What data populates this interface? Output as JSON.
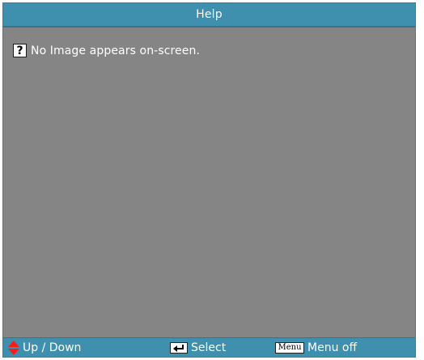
{
  "window": {
    "title": "Help"
  },
  "help": {
    "icon": "question-mark-icon",
    "icon_glyph": "?",
    "message": "No Image appears on-screen."
  },
  "footer": {
    "up_down": {
      "icon": "up-down-arrows-icon",
      "label": "Up / Down",
      "icon_color": "#ff1a1a"
    },
    "select": {
      "icon": "enter-key-icon",
      "label": "Select"
    },
    "menu_off": {
      "key_label": "Menu",
      "label": "Menu off"
    }
  },
  "colors": {
    "title_bar": "#3f8fae",
    "panel_background": "#858585",
    "text": "#ffffff"
  }
}
